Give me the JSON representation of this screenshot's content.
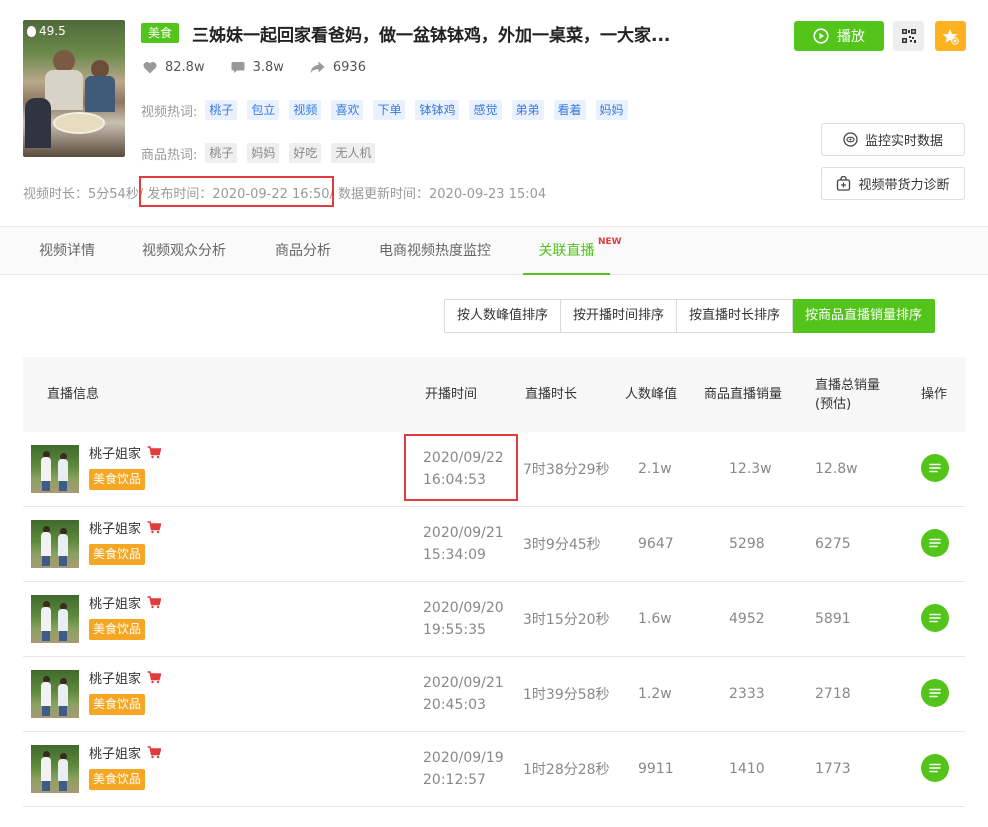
{
  "video": {
    "heat": "49.5",
    "category": "美食",
    "title": "三姊妹一起回家看爸妈，做一盆钵钵鸡，外加一桌菜，一大家...",
    "likes": "82.8w",
    "comments": "3.8w",
    "shares": "6936",
    "video_hot_label": "视频热词:",
    "video_hot_words": [
      "桃子",
      "包立",
      "视频",
      "喜欢",
      "下单",
      "钵钵鸡",
      "感觉",
      "弟弟",
      "看着",
      "妈妈"
    ],
    "product_hot_label": "商品热词:",
    "product_hot_words": [
      "桃子",
      "妈妈",
      "好吃",
      "无人机"
    ],
    "duration_text": "视频时长：5分54秒",
    "publish_text": "/ 发布时间：2020-09-22 16:50",
    "update_text": "/ 数据更新时间：2020-09-23 15:04"
  },
  "actions": {
    "play_label": "播放",
    "monitor_label": "监控实时数据",
    "diagnose_label": "视频带货力诊断"
  },
  "tabs": [
    {
      "label": "视频详情",
      "active": false
    },
    {
      "label": "视频观众分析",
      "active": false
    },
    {
      "label": "商品分析",
      "active": false
    },
    {
      "label": "电商视频热度监控",
      "active": false
    },
    {
      "label": "关联直播",
      "active": true,
      "badge": "NEW"
    }
  ],
  "sort_buttons": [
    {
      "label": "按人数峰值排序",
      "active": false
    },
    {
      "label": "按开播时间排序",
      "active": false
    },
    {
      "label": "按直播时长排序",
      "active": false
    },
    {
      "label": "按商品直播销量排序",
      "active": true
    }
  ],
  "table": {
    "headers": {
      "info": "直播信息",
      "start": "开播时间",
      "duration": "直播时长",
      "peak": "人数峰值",
      "sales": "商品直播销量",
      "total": "直播总销量",
      "total_sub": "(预估)",
      "op": "操作"
    },
    "rows": [
      {
        "name": "桃子姐家",
        "category": "美食饮品",
        "date": "2020/09/22",
        "time": "16:04:53",
        "duration": "7时38分29秒",
        "peak": "2.1w",
        "sales": "12.3w",
        "total": "12.8w"
      },
      {
        "name": "桃子姐家",
        "category": "美食饮品",
        "date": "2020/09/21",
        "time": "15:34:09",
        "duration": "3时9分45秒",
        "peak": "9647",
        "sales": "5298",
        "total": "6275"
      },
      {
        "name": "桃子姐家",
        "category": "美食饮品",
        "date": "2020/09/20",
        "time": "19:55:35",
        "duration": "3时15分20秒",
        "peak": "1.6w",
        "sales": "4952",
        "total": "5891"
      },
      {
        "name": "桃子姐家",
        "category": "美食饮品",
        "date": "2020/09/21",
        "time": "20:45:03",
        "duration": "1时39分58秒",
        "peak": "1.2w",
        "sales": "2333",
        "total": "2718"
      },
      {
        "name": "桃子姐家",
        "category": "美食饮品",
        "date": "2020/09/19",
        "time": "20:12:57",
        "duration": "1时28分28秒",
        "peak": "9911",
        "sales": "1410",
        "total": "1773"
      }
    ]
  },
  "colors": {
    "accent": "#52c41a",
    "highlight": "#e23b3b",
    "badge": "#f5a623",
    "star": "#fdb21e"
  }
}
